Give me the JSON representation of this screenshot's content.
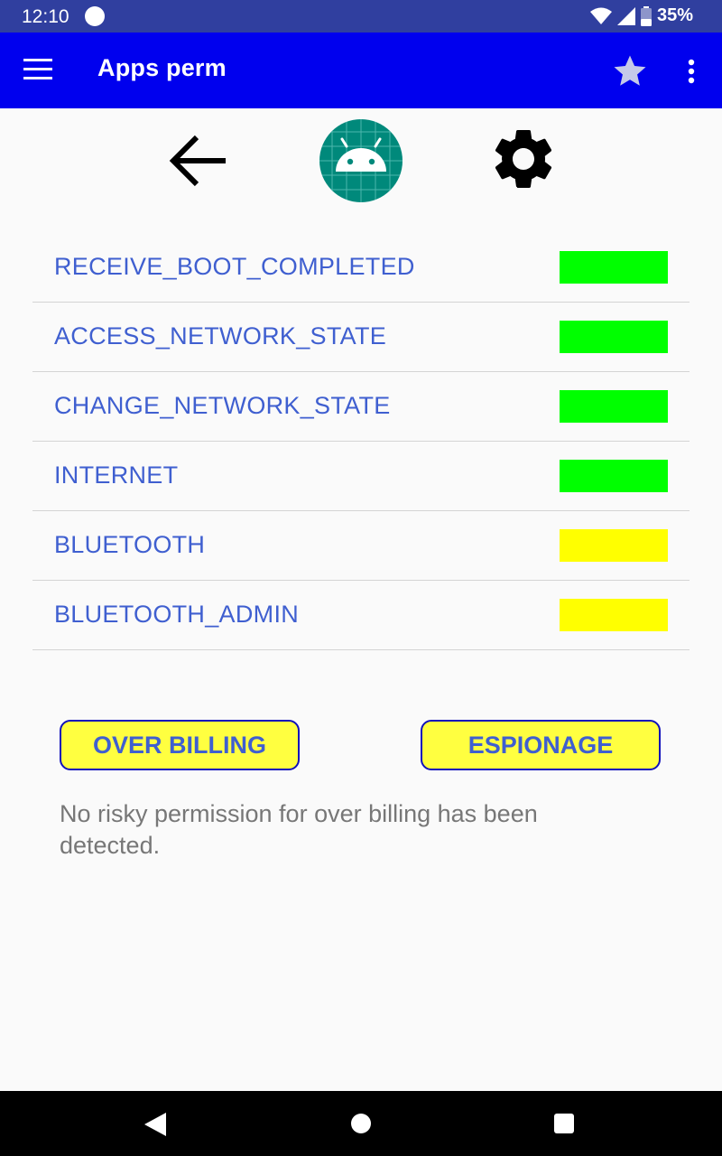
{
  "status_bar": {
    "time": "12:10",
    "battery": "35%",
    "icons": [
      "wifi-icon",
      "signal-icon",
      "battery-icon"
    ]
  },
  "app_bar": {
    "title": "Apps perm",
    "icons": [
      "menu-icon",
      "star-icon",
      "more-vert-icon"
    ]
  },
  "toolbar_icons": [
    "back-arrow-icon",
    "android-app-icon",
    "settings-gear-icon"
  ],
  "permissions": [
    {
      "name": "RECEIVE_BOOT_COMPLETED",
      "color": "#00ff00"
    },
    {
      "name": "ACCESS_NETWORK_STATE",
      "color": "#00ff00"
    },
    {
      "name": "CHANGE_NETWORK_STATE",
      "color": "#00ff00"
    },
    {
      "name": "INTERNET",
      "color": "#00ff00"
    },
    {
      "name": "BLUETOOTH",
      "color": "#ffff00"
    },
    {
      "name": "BLUETOOTH_ADMIN",
      "color": "#ffff00"
    }
  ],
  "buttons": {
    "over_billing": "OVER BILLING",
    "espionage": "ESPIONAGE"
  },
  "message": "No risky permission for over billing has been detected.",
  "colors": {
    "app_bar": "#0000ee",
    "status_bar": "#303f9f",
    "label_text": "#3f5fd0",
    "button_fill": "#ffff40"
  }
}
